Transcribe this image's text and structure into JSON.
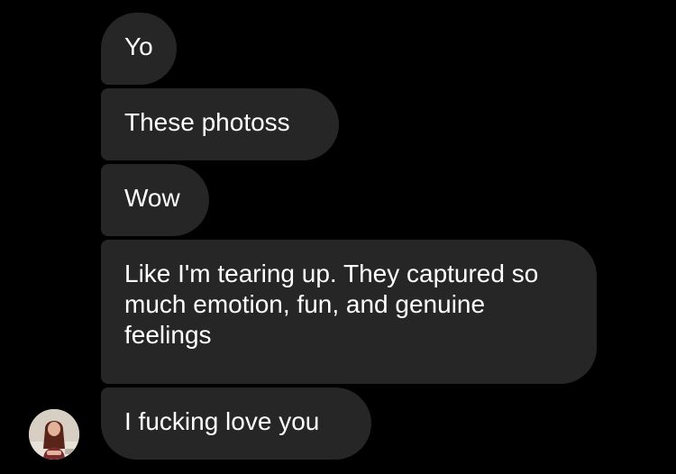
{
  "conversation": {
    "messages": [
      {
        "text": "Yo"
      },
      {
        "text": "These photoss"
      },
      {
        "text": "Wow"
      },
      {
        "text": "Like I'm tearing up. They captured so much emotion, fun, and genuine feelings"
      },
      {
        "text": "I fucking love you"
      }
    ],
    "avatar_icon": "user-avatar-photo",
    "colors": {
      "background": "#000000",
      "bubble": "#262626",
      "text": "#ffffff"
    }
  }
}
